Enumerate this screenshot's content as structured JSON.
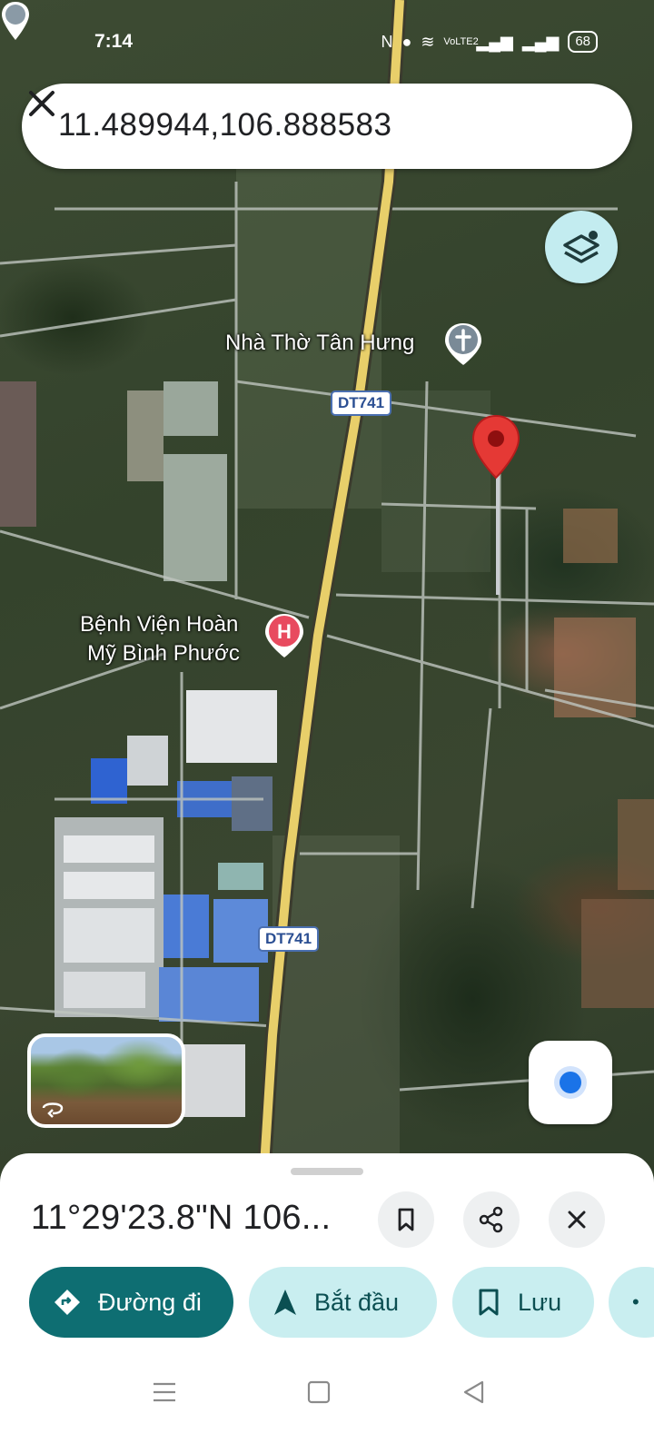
{
  "status_bar": {
    "time": "7:14",
    "network": "VoLTE2",
    "battery": "68"
  },
  "search": {
    "value": "11.489944,106.888583",
    "clear_icon": "close-icon"
  },
  "map": {
    "labels": {
      "church": "Nhà Thờ Tân Hưng",
      "hospital_line1": "Bệnh Viện Hoàn",
      "hospital_line2": "Mỹ Bình Phước",
      "road_top": "DT741",
      "road_bottom": "DT741"
    },
    "icons": {
      "layers": "layers-icon",
      "church": "church-icon",
      "hospital": "hospital-icon",
      "pin": "location-pin-icon",
      "pegman": "pegman-icon",
      "my_location": "my-location-icon"
    },
    "colors": {
      "pin": "#e53935",
      "hospital": "#e84a5f",
      "road": "#e8cf6a"
    }
  },
  "sheet": {
    "title": "11°29'23.8\"N 106...",
    "actions": {
      "directions": "Đường đi",
      "start": "Bắt đầu",
      "save": "Lưu"
    },
    "colors": {
      "primary": "#0e6e72",
      "secondary": "#c9eef0"
    }
  }
}
